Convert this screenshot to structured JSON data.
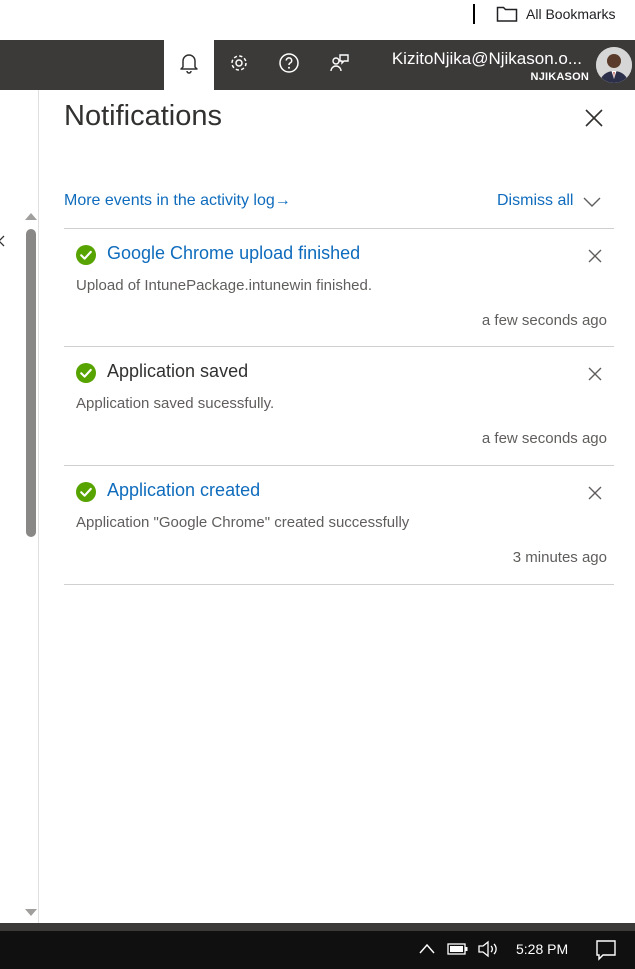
{
  "bookmarks": {
    "label": "All Bookmarks"
  },
  "header": {
    "user_name": "KizitoNjika@Njikason.o...",
    "directory": "NJIKASON"
  },
  "panel": {
    "title": "Notifications",
    "activity_link": "More events in the activity log",
    "activity_arrow": "→",
    "dismiss_all": "Dismiss all"
  },
  "notifications": [
    {
      "title": "Google Chrome upload finished",
      "title_style": "link",
      "description": "Upload of IntunePackage.intunewin finished.",
      "time": "a few seconds ago",
      "status": "success"
    },
    {
      "title": "Application saved",
      "title_style": "plain",
      "description": "Application saved sucessfully.",
      "time": "a few seconds ago",
      "status": "success"
    },
    {
      "title": "Application created",
      "title_style": "link",
      "description": "Application \"Google Chrome\" created successfully",
      "time": "3 minutes ago",
      "status": "success"
    }
  ],
  "taskbar": {
    "time": "5:28 PM"
  },
  "colors": {
    "accent": "#0f6cbd",
    "success": "#57a300",
    "header_bg": "#3b3a39",
    "taskbar_bg": "#101010"
  },
  "icons": [
    "folder-icon",
    "bell-icon",
    "gear-icon",
    "help-icon",
    "feedback-icon",
    "close-icon",
    "chevron-down-icon",
    "check-circle-icon",
    "chevron-up-icon",
    "battery-icon",
    "speaker-icon",
    "action-center-icon"
  ]
}
